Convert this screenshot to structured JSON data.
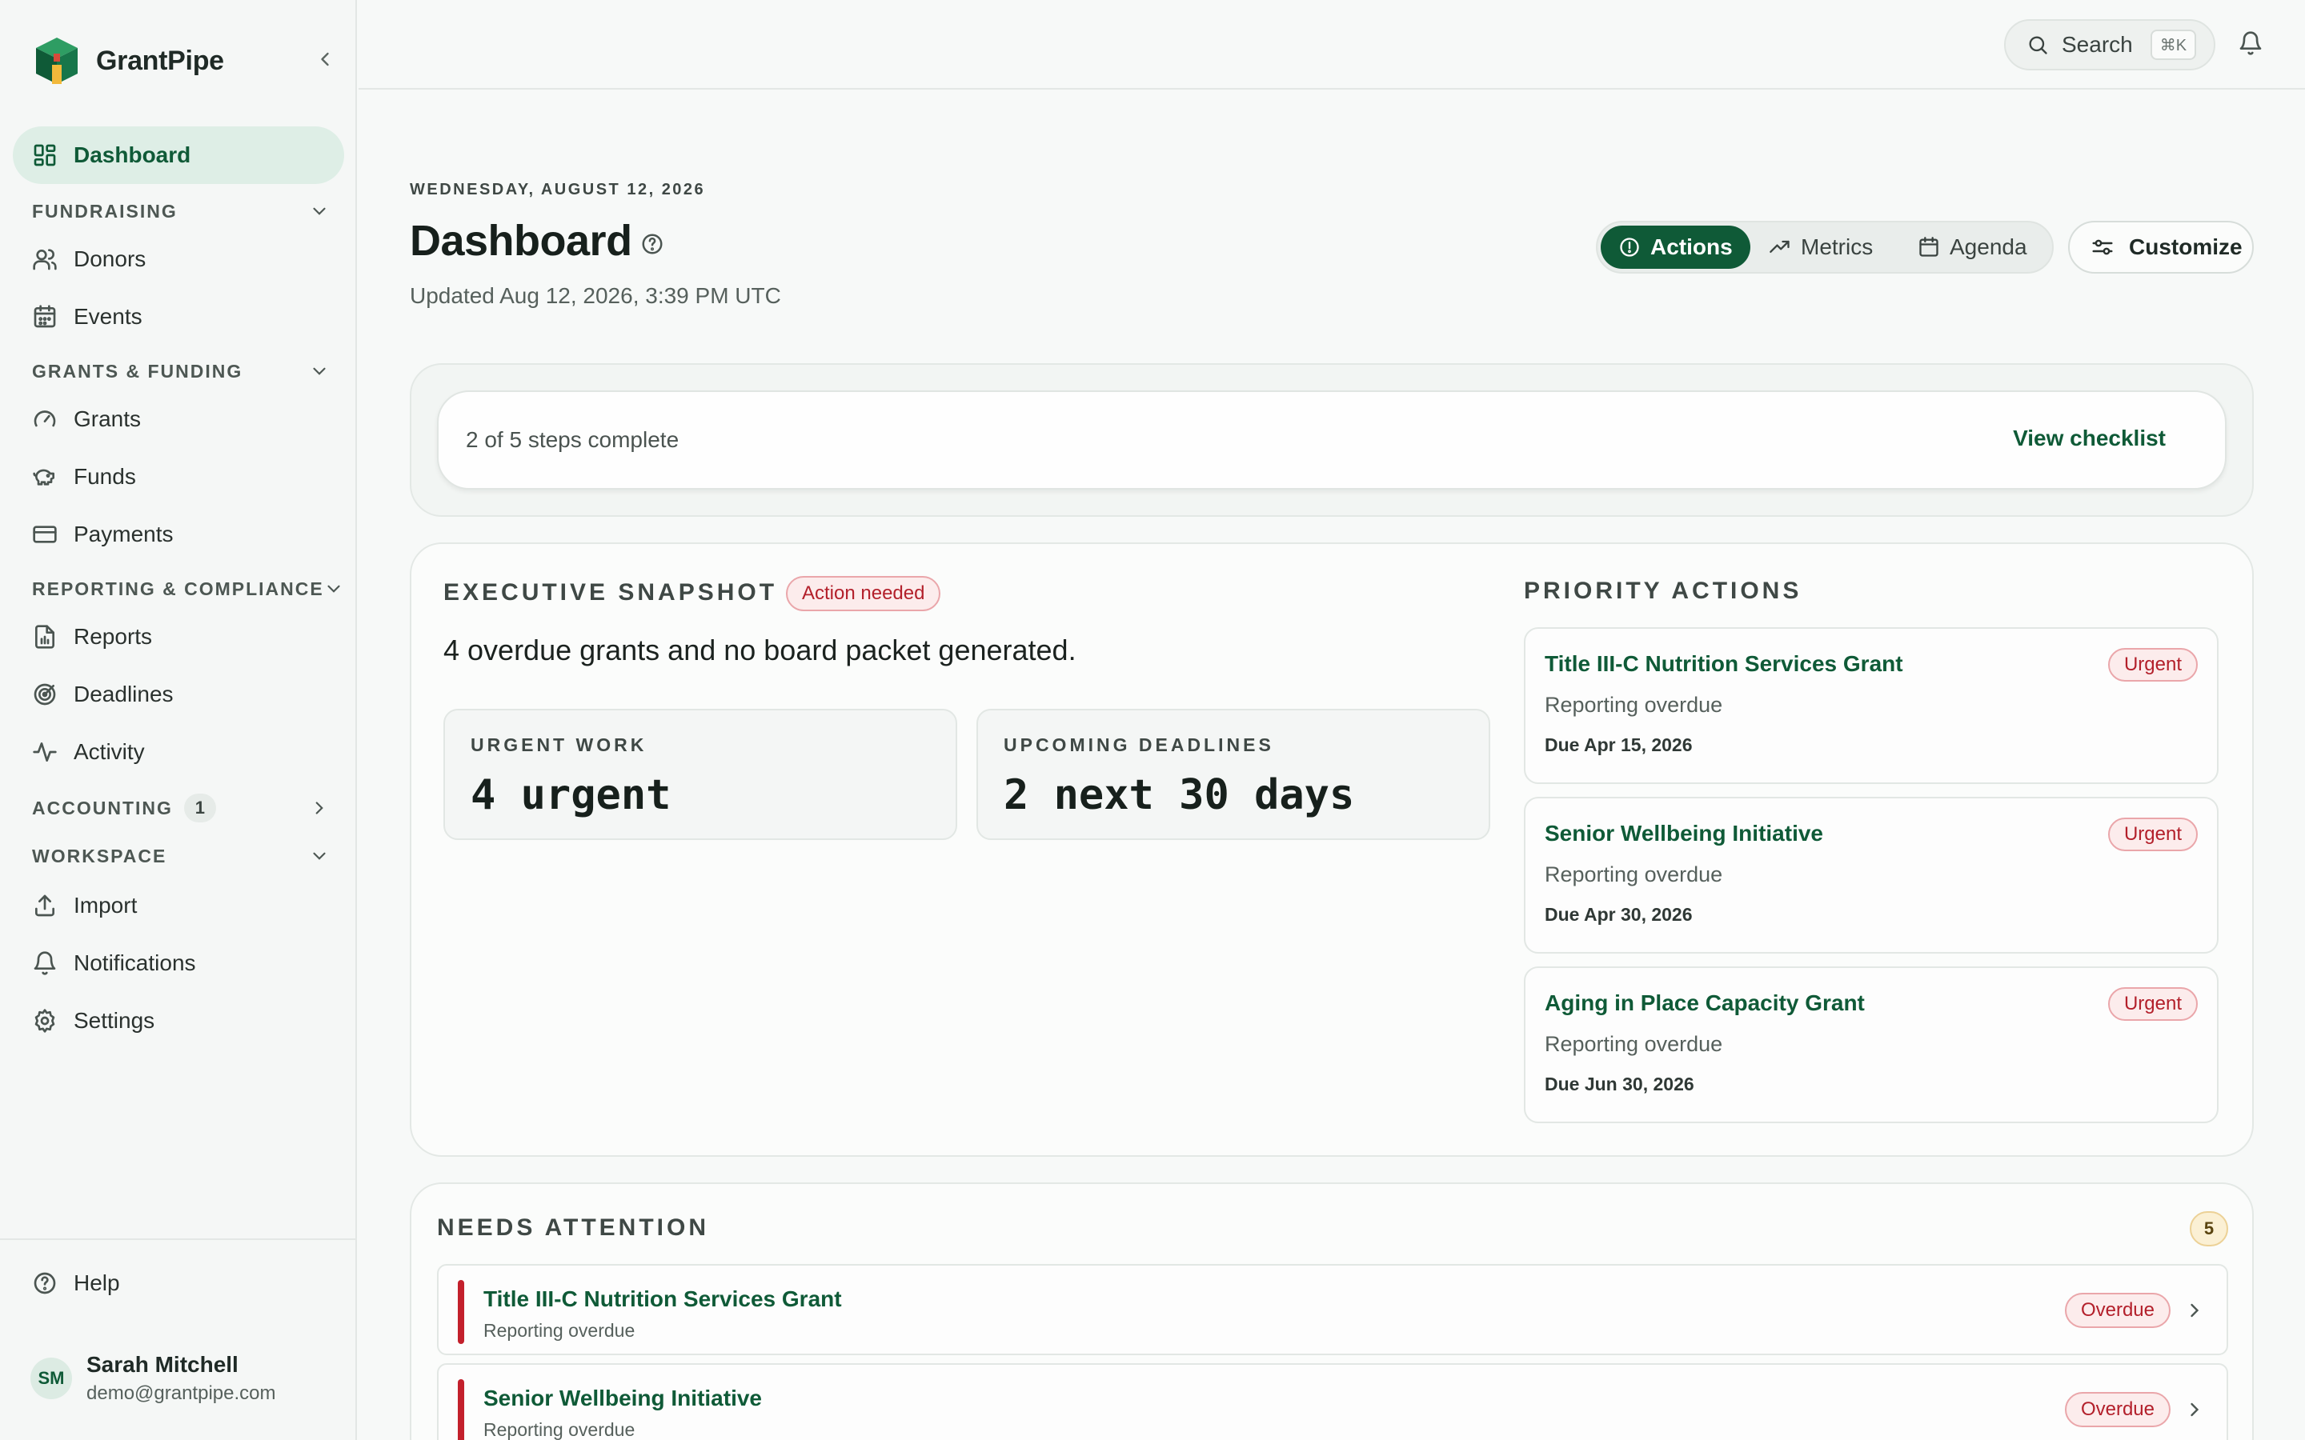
{
  "brand": {
    "name": "GrantPipe"
  },
  "sidebar": {
    "dashboard": "Dashboard",
    "sections": {
      "fundraising": "FUNDRAISING",
      "grants": "GRANTS & FUNDING",
      "reporting": "REPORTING & COMPLIANCE",
      "accounting": "ACCOUNTING",
      "accounting_badge": "1",
      "workspace": "WORKSPACE"
    },
    "items": {
      "donors": "Donors",
      "events": "Events",
      "grants": "Grants",
      "funds": "Funds",
      "payments": "Payments",
      "reports": "Reports",
      "deadlines": "Deadlines",
      "activity": "Activity",
      "import": "Import",
      "notifications": "Notifications",
      "settings": "Settings",
      "help": "Help"
    },
    "user": {
      "initials": "SM",
      "name": "Sarah Mitchell",
      "email": "demo@grantpipe.com"
    }
  },
  "topbar": {
    "search_label": "Search",
    "search_shortcut": "⌘K"
  },
  "header": {
    "date": "WEDNESDAY, AUGUST 12, 2026",
    "title": "Dashboard",
    "updated": "Updated Aug 12, 2026, 3:39 PM UTC",
    "views": [
      "Actions",
      "Metrics",
      "Agenda"
    ],
    "active_view": "Actions",
    "customize": "Customize"
  },
  "checklist": {
    "progress": "2 of 5 steps complete",
    "link": "View checklist"
  },
  "snapshot": {
    "title": "EXECUTIVE SNAPSHOT",
    "status": "Action needed",
    "headline": "4 overdue grants and no board packet generated.",
    "stats": [
      {
        "label": "URGENT WORK",
        "value": "4 urgent"
      },
      {
        "label": "UPCOMING DEADLINES",
        "value": "2 next 30 days"
      }
    ]
  },
  "priority": {
    "title": "PRIORITY ACTIONS",
    "items": [
      {
        "title": "Title III-C Nutrition Services Grant",
        "subtitle": "Reporting overdue",
        "due": "Due Apr 15, 2026",
        "tag": "Urgent"
      },
      {
        "title": "Senior Wellbeing Initiative",
        "subtitle": "Reporting overdue",
        "due": "Due Apr 30, 2026",
        "tag": "Urgent"
      },
      {
        "title": "Aging in Place Capacity Grant",
        "subtitle": "Reporting overdue",
        "due": "Due Jun 30, 2026",
        "tag": "Urgent"
      }
    ]
  },
  "attention": {
    "title": "NEEDS ATTENTION",
    "count": "5",
    "rows": [
      {
        "title": "Title III-C Nutrition Services Grant",
        "subtitle": "Reporting overdue",
        "tag": "Overdue"
      },
      {
        "title": "Senior Wellbeing Initiative",
        "subtitle": "Reporting overdue",
        "tag": "Overdue"
      }
    ]
  },
  "colors": {
    "brand_green": "#0f5a37",
    "urgent_red": "#b3202b",
    "active_nav_bg": "#deeee6"
  }
}
